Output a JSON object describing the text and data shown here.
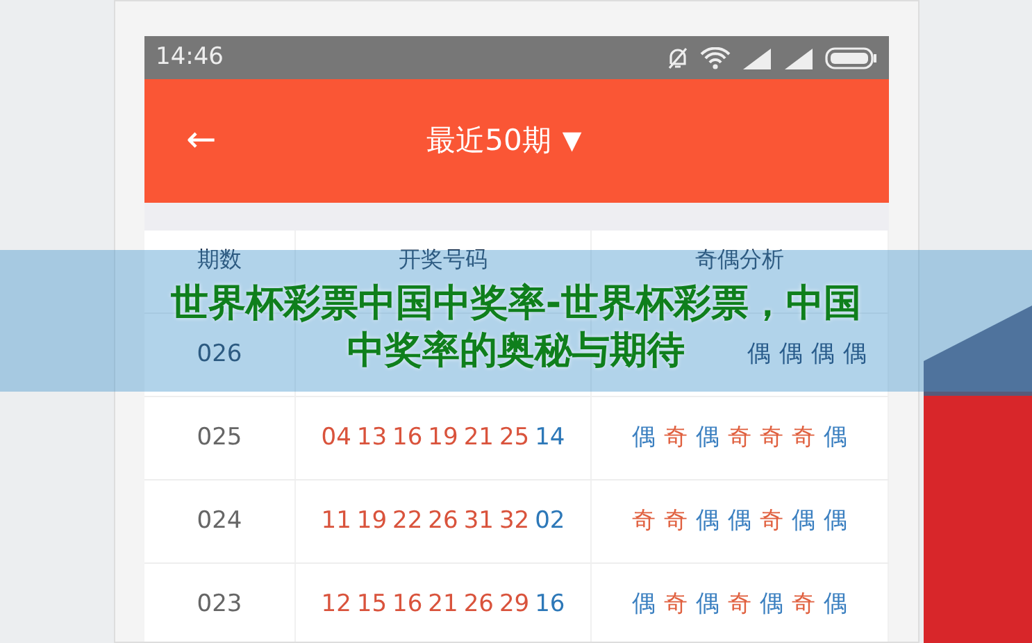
{
  "status_bar": {
    "time": "14:46"
  },
  "header": {
    "back": "←",
    "title": "最近50期",
    "dropdown": "▼"
  },
  "table": {
    "columns": [
      "期数",
      "开奖号码",
      "奇偶分析"
    ],
    "rows": [
      {
        "issue": "026",
        "numbers": [],
        "parity": [
          {
            "text": "偶",
            "kind": "even"
          },
          {
            "text": "偶",
            "kind": "even"
          },
          {
            "text": "偶",
            "kind": "even"
          },
          {
            "text": "偶",
            "kind": "even"
          }
        ]
      },
      {
        "issue": "025",
        "numbers": [
          {
            "text": "04",
            "kind": "front"
          },
          {
            "text": "13",
            "kind": "front"
          },
          {
            "text": "16",
            "kind": "front"
          },
          {
            "text": "19",
            "kind": "front"
          },
          {
            "text": "21",
            "kind": "front"
          },
          {
            "text": "25",
            "kind": "front"
          },
          {
            "text": "14",
            "kind": "back"
          }
        ],
        "parity": [
          {
            "text": "偶",
            "kind": "even"
          },
          {
            "text": "奇",
            "kind": "odd"
          },
          {
            "text": "偶",
            "kind": "even"
          },
          {
            "text": "奇",
            "kind": "odd"
          },
          {
            "text": "奇",
            "kind": "odd"
          },
          {
            "text": "奇",
            "kind": "odd"
          },
          {
            "text": "偶",
            "kind": "even"
          }
        ]
      },
      {
        "issue": "024",
        "numbers": [
          {
            "text": "11",
            "kind": "front"
          },
          {
            "text": "19",
            "kind": "front"
          },
          {
            "text": "22",
            "kind": "front"
          },
          {
            "text": "26",
            "kind": "front"
          },
          {
            "text": "31",
            "kind": "front"
          },
          {
            "text": "32",
            "kind": "front"
          },
          {
            "text": "02",
            "kind": "back"
          }
        ],
        "parity": [
          {
            "text": "奇",
            "kind": "odd"
          },
          {
            "text": "奇",
            "kind": "odd"
          },
          {
            "text": "偶",
            "kind": "even"
          },
          {
            "text": "偶",
            "kind": "even"
          },
          {
            "text": "奇",
            "kind": "odd"
          },
          {
            "text": "偶",
            "kind": "even"
          },
          {
            "text": "偶",
            "kind": "even"
          }
        ]
      },
      {
        "issue": "023",
        "numbers": [
          {
            "text": "12",
            "kind": "front"
          },
          {
            "text": "15",
            "kind": "front"
          },
          {
            "text": "16",
            "kind": "front"
          },
          {
            "text": "21",
            "kind": "front"
          },
          {
            "text": "26",
            "kind": "front"
          },
          {
            "text": "29",
            "kind": "front"
          },
          {
            "text": "16",
            "kind": "back"
          }
        ],
        "parity": [
          {
            "text": "偶",
            "kind": "even"
          },
          {
            "text": "奇",
            "kind": "odd"
          },
          {
            "text": "偶",
            "kind": "even"
          },
          {
            "text": "奇",
            "kind": "odd"
          },
          {
            "text": "偶",
            "kind": "even"
          },
          {
            "text": "奇",
            "kind": "odd"
          },
          {
            "text": "偶",
            "kind": "even"
          }
        ]
      }
    ]
  },
  "banner": {
    "lines": [
      "世界杯彩票中国中奖率-世界杯彩票，中国",
      "中奖率的奥秘与期待"
    ]
  }
}
